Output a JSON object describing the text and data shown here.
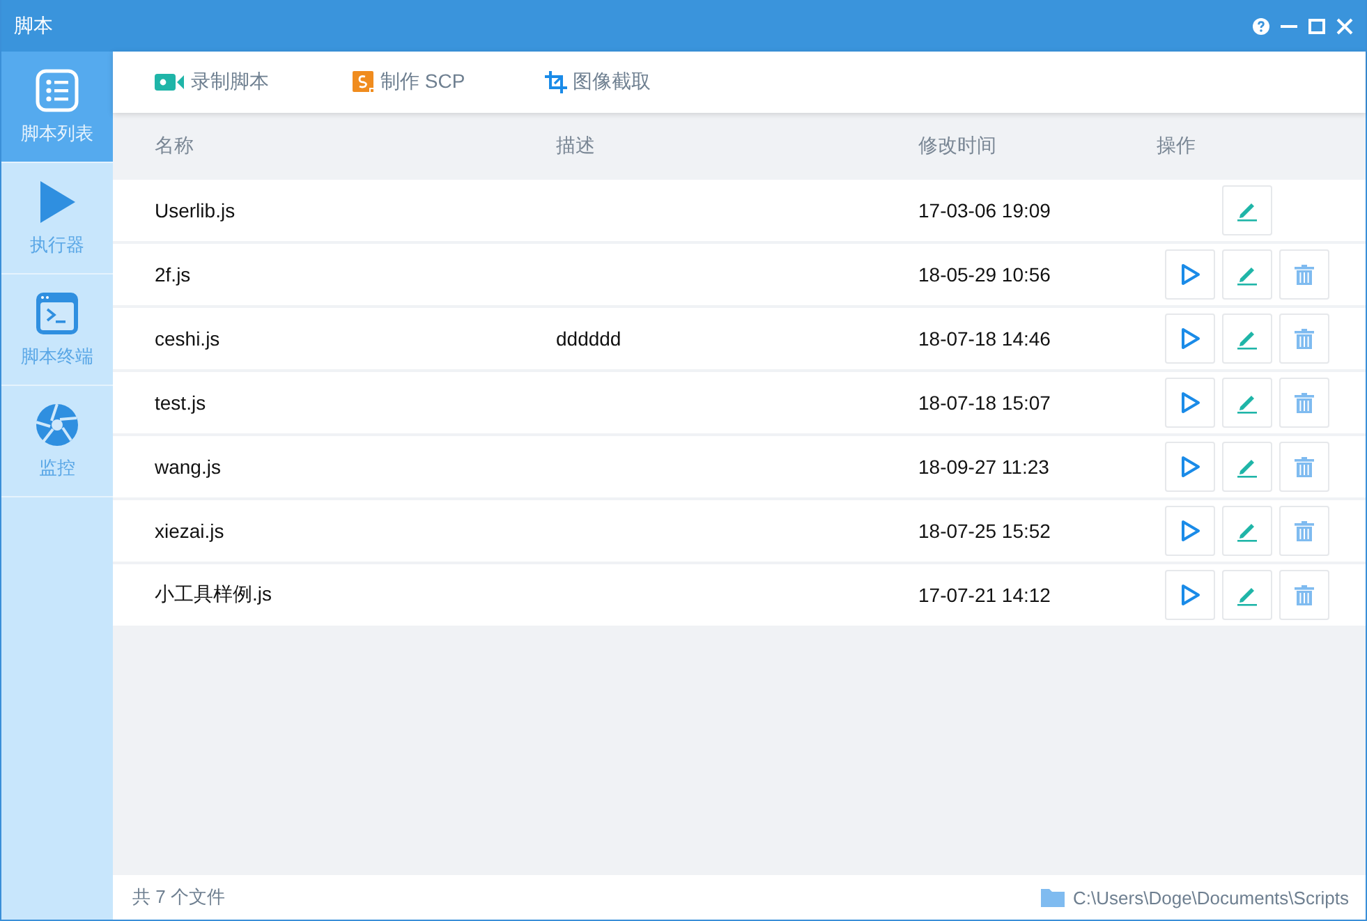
{
  "window": {
    "title": "脚本"
  },
  "sidebar": {
    "items": [
      {
        "kind": "list",
        "label": "脚本列表",
        "selected": true
      },
      {
        "kind": "run",
        "label": "执行器",
        "selected": false
      },
      {
        "kind": "terminal",
        "label": "脚本终端",
        "selected": false
      },
      {
        "kind": "monitor",
        "label": "监控",
        "selected": false
      }
    ]
  },
  "toolbar": [
    {
      "kind": "record",
      "label": "录制脚本"
    },
    {
      "kind": "scp",
      "label": "制作 SCP"
    },
    {
      "kind": "crop",
      "label": "图像截取"
    }
  ],
  "table": {
    "columns": [
      "名称",
      "描述",
      "修改时间",
      "操作"
    ],
    "rows": [
      {
        "name": "Userlib.js",
        "description": "",
        "modified": "17-03-06 19:09",
        "actions": [
          {
            "kind": "edit"
          }
        ]
      },
      {
        "name": "2f.js",
        "description": "",
        "modified": "18-05-29 10:56",
        "actions": [
          {
            "kind": "run"
          },
          {
            "kind": "edit"
          },
          {
            "kind": "delete"
          }
        ]
      },
      {
        "name": "ceshi.js",
        "description": "dddddd",
        "modified": "18-07-18 14:46",
        "actions": [
          {
            "kind": "run"
          },
          {
            "kind": "edit"
          },
          {
            "kind": "delete"
          }
        ]
      },
      {
        "name": "test.js",
        "description": "",
        "modified": "18-07-18 15:07",
        "actions": [
          {
            "kind": "run"
          },
          {
            "kind": "edit"
          },
          {
            "kind": "delete"
          }
        ]
      },
      {
        "name": "wang.js",
        "description": "",
        "modified": "18-09-27 11:23",
        "actions": [
          {
            "kind": "run"
          },
          {
            "kind": "edit"
          },
          {
            "kind": "delete"
          }
        ]
      },
      {
        "name": "xiezai.js",
        "description": "",
        "modified": "18-07-25 15:52",
        "actions": [
          {
            "kind": "run"
          },
          {
            "kind": "edit"
          },
          {
            "kind": "delete"
          }
        ]
      },
      {
        "name": "小工具样例.js",
        "description": "",
        "modified": "17-07-21 14:12",
        "actions": [
          {
            "kind": "run"
          },
          {
            "kind": "edit"
          },
          {
            "kind": "delete"
          }
        ]
      }
    ]
  },
  "status_bar": {
    "file_count": "共 7 个文件",
    "path": "C:\\Users\\Doge\\Documents\\Scripts"
  }
}
